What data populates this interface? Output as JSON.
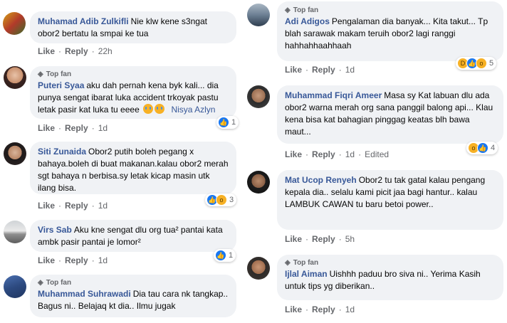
{
  "actions": {
    "like": "Like",
    "reply": "Reply",
    "edited": "Edited",
    "top_fan": "Top fan"
  },
  "left_comments": [
    {
      "author": "Muhamad Adib Zulkifli",
      "text": "Nie klw kene s3ngat obor2 bertatu la smpai ke tua",
      "time": "22h"
    },
    {
      "author": "Puteri Syaa",
      "text": "aku dah pernah kena byk kali... dia punya sengat ibarat luka accident trkoyak pastu letak pasir kat luka tu eeee",
      "mention": "Nisya Azlyn",
      "time": "1d",
      "reaction_count": "1"
    },
    {
      "author": "Siti Zunaida",
      "text": "Obor2 putih boleh pegang x bahaya.boleh di buat makanan.kalau obor2 merah sgt bahaya n berbisa.sy letak kicap masin utk ilang bisa.",
      "time": "1d",
      "reaction_count": "3"
    },
    {
      "author": "Virs Sab",
      "text": "Aku kne sengat dlu org tua² pantai kata ambk pasir pantai je lomor²",
      "time": "1d",
      "reaction_count": "1"
    },
    {
      "author": "Muhammad Suhrawadi",
      "text": "Dia tau cara nk tangkap.. Bagus ni.. Belajaq kt dia.. Ilmu jugak",
      "time": "1d"
    }
  ],
  "right_comments": [
    {
      "author": "Adi Adigos",
      "text": "Pengalaman dia banyak... Kita takut... Tp blah sarawak makam teruih obor2 lagi ranggi hahhahhaahhaah",
      "time": "1d",
      "reaction_count": "5"
    },
    {
      "author": "Muhammad Fiqri Ameer",
      "text": "Masa sy Kat labuan dlu ada obor2 warna merah org sana panggil balong api... Klau kena bisa kat bahagian pinggag keatas blh bawa maut...",
      "time": "1d",
      "reaction_count": "4"
    },
    {
      "author": "Mat Ucop Renyeh",
      "text": "Obor2 tu tak gatal kalau pengang kepala dia.. selalu kami picit jaa bagi hantur.. kalau LAMBUK CAWAN tu baru betoi power..",
      "time": "5h"
    },
    {
      "author": "Ijlal Aiman",
      "text": "Uishhh paduu bro siva ni.. Yerima Kasih untuk tips yg diberikan..",
      "time": "1d"
    }
  ],
  "colors": {
    "link": "#385898",
    "bubble": "#f0f2f5",
    "meta": "#65676b",
    "like": "#1877f2",
    "emoji": "#f7b125"
  }
}
